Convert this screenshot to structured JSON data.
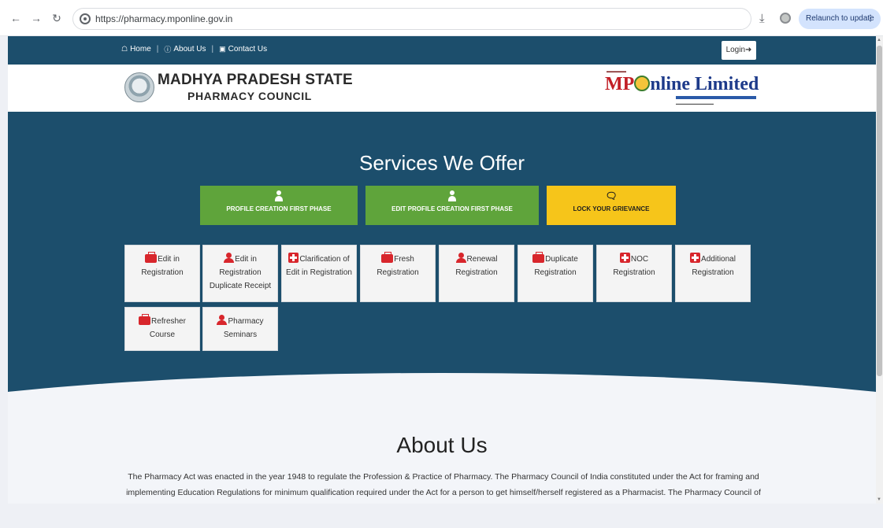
{
  "browser": {
    "url": "https://pharmacy.mponline.gov.in",
    "relaunch_label": "Relaunch to update"
  },
  "topnav": {
    "home": "Home",
    "about": "About Us",
    "contact": "Contact Us",
    "login": "Login"
  },
  "header": {
    "council_line1": "MADHYA PRADESH STATE",
    "council_line2": "PHARMACY COUNCIL",
    "mp_logo_prefix": "MP",
    "mp_logo_suffix": "nline Limited"
  },
  "services": {
    "title": "Services We Offer",
    "phase_buttons": [
      {
        "label": "PROFILE CREATION FIRST PHASE",
        "icon": "user-icon",
        "color": "#5fa43b"
      },
      {
        "label": "EDIT PROFILE CREATION FIRST PHASE",
        "icon": "user-icon",
        "color": "#5fa43b"
      },
      {
        "label": "LOCK YOUR GRIEVANCE",
        "icon": "chat-icon",
        "color": "#f6c51a"
      }
    ],
    "tiles": [
      {
        "lines": [
          "Edit in",
          "Registration"
        ],
        "icon": "briefcase-icon"
      },
      {
        "lines": [
          "Edit in",
          "Registration",
          "Duplicate Receipt"
        ],
        "icon": "user-icon"
      },
      {
        "lines": [
          "Clarification of",
          "Edit in Registration"
        ],
        "icon": "plus-square-icon"
      },
      {
        "lines": [
          "Fresh",
          "Registration"
        ],
        "icon": "briefcase-icon"
      },
      {
        "lines": [
          "Renewal",
          "Registration"
        ],
        "icon": "user-icon"
      },
      {
        "lines": [
          "Duplicate",
          "Registration"
        ],
        "icon": "briefcase-icon"
      },
      {
        "lines": [
          "NOC",
          "Registration"
        ],
        "icon": "plus-square-icon"
      },
      {
        "lines": [
          "Additional",
          "Registration"
        ],
        "icon": "plus-square-icon"
      },
      {
        "lines": [
          "Refresher",
          "Course"
        ],
        "icon": "briefcase-icon"
      },
      {
        "lines": [
          "Pharmacy",
          "Seminars"
        ],
        "icon": "user-icon"
      }
    ]
  },
  "about": {
    "title": "About Us",
    "text": "The Pharmacy Act was enacted in the year 1948 to regulate the Profession & Practice of Pharmacy. The Pharmacy Council of India constituted under the Act for framing and implementing Education Regulations for minimum qualification required under the Act for a person to get himself/herself registered as a Pharmacist. The Pharmacy Council of"
  }
}
